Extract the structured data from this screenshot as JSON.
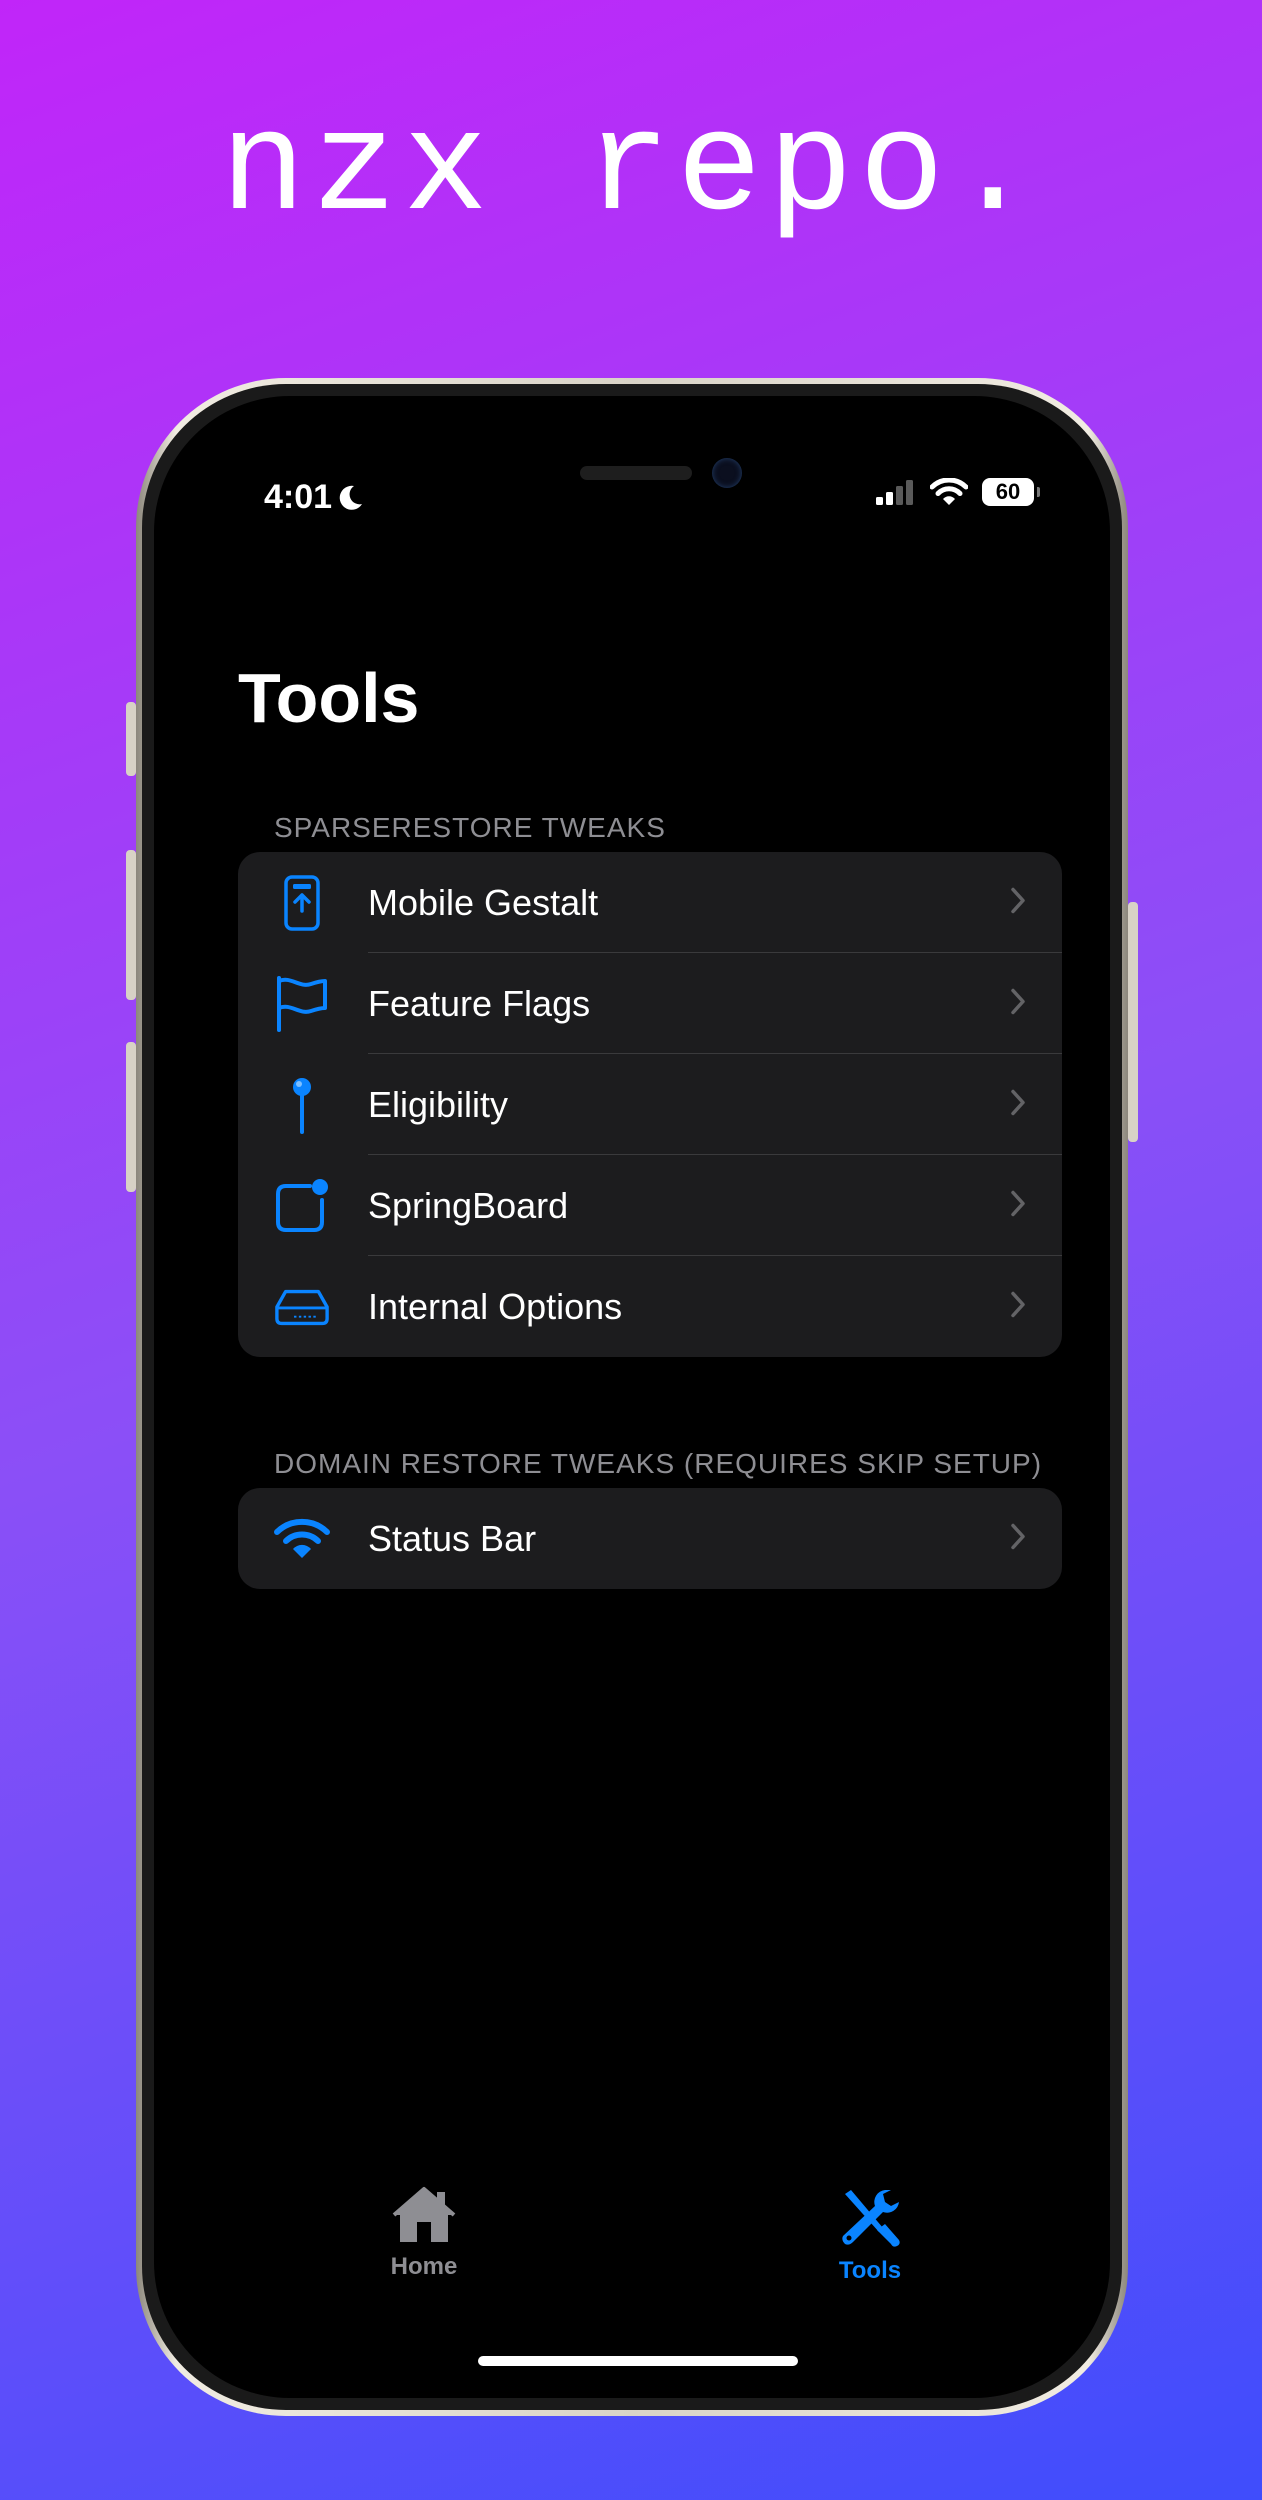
{
  "headline": "nzx repo.",
  "status_bar": {
    "time": "4:01",
    "battery": "60"
  },
  "page": {
    "title": "Tools"
  },
  "sections": [
    {
      "header": "SPARSERESTORE TWEAKS",
      "items": [
        {
          "label": "Mobile Gestalt",
          "icon": "phone-arrow-up-icon"
        },
        {
          "label": "Feature Flags",
          "icon": "flag-icon"
        },
        {
          "label": "Eligibility",
          "icon": "pin-icon"
        },
        {
          "label": "SpringBoard",
          "icon": "app-badge-icon"
        },
        {
          "label": "Internal Options",
          "icon": "internal-drive-icon"
        }
      ]
    },
    {
      "header": "DOMAIN RESTORE TWEAKS (REQUIRES SKIP SETUP)",
      "items": [
        {
          "label": "Status Bar",
          "icon": "wifi-icon"
        }
      ]
    }
  ],
  "tab_bar": {
    "tabs": [
      {
        "label": "Home",
        "icon": "house-icon",
        "selected": false
      },
      {
        "label": "Tools",
        "icon": "wrench-screwdriver-icon",
        "selected": true
      }
    ]
  },
  "colors": {
    "accent": "#0a84ff",
    "background": "#000000",
    "group_background": "#1c1c1e",
    "gradient_top": "#c125f9",
    "gradient_bottom": "#3f4dfc"
  }
}
